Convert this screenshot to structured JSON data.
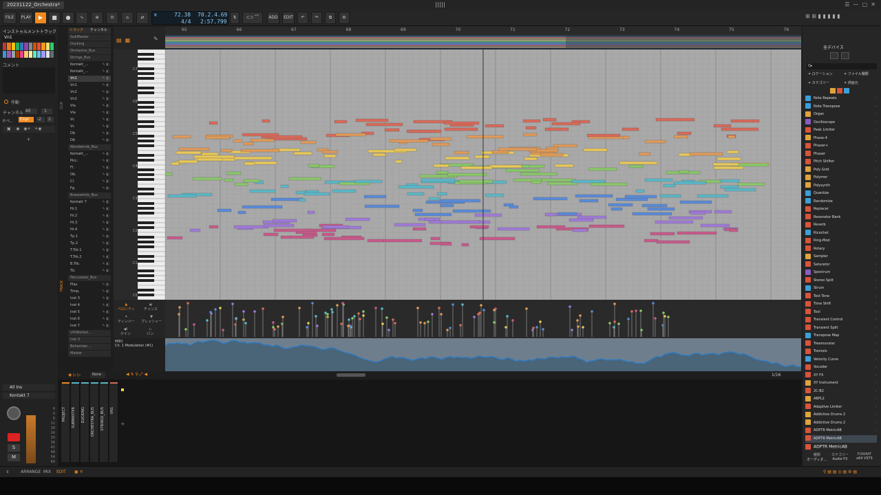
{
  "window": {
    "title": "20231122_Orchestra*"
  },
  "toolbar": {
    "file": "FILE",
    "play": "PLAY",
    "add": "ADD",
    "edit": "EDIT",
    "tempo": "72.38",
    "time_sig": "4/4",
    "position": "70.2.4.69",
    "time": "2:57.799",
    "accent": "#f08a1e"
  },
  "left_panel": {
    "header": "インストゥルメントトラック",
    "track_name": "Vn1",
    "comment": "コメント",
    "action": "作動",
    "channel_label": "チャンネル",
    "channel_value": "All",
    "channel_num": "1",
    "expr_label": "P.ベ..",
    "expr_value": "Expr",
    "expr_nums": "-2",
    "expr_num2": "2",
    "palette": [
      "#c0392b",
      "#e67e22",
      "#f1c40f",
      "#27ae60",
      "#2980b9",
      "#8e44ad",
      "#7f8c8d",
      "#d35400",
      "#e74c3c",
      "#f39c12",
      "#f7dc6f",
      "#2ecc71",
      "#3498db",
      "#9b59b6",
      "#95a5a6",
      "#a04000",
      "#e84393",
      "#fdcb6e",
      "#ffeaa7",
      "#55efc4",
      "#74b9ff",
      "#a29bfe",
      "#dfe6e9",
      "#636e72"
    ]
  },
  "tracklist": {
    "tab_track": "トラック",
    "tab_channel": "チャンネル",
    "clip_label": "CLIP",
    "track_label": "TRACK",
    "tracks": [
      {
        "name": "SubMaster",
        "bus": true
      },
      {
        "name": "Ducking",
        "bus": true
      },
      {
        "name": "Orchestra_Bus",
        "bus": true
      },
      {
        "name": "Strings_Bus",
        "bus": true
      },
      {
        "name": "Kontakt_..."
      },
      {
        "name": "Kontakt_..."
      },
      {
        "name": "Vn1",
        "sel": true
      },
      {
        "name": "Vn1"
      },
      {
        "name": "Vn2"
      },
      {
        "name": "Vn2"
      },
      {
        "name": "Vla"
      },
      {
        "name": "Vla"
      },
      {
        "name": "Vc"
      },
      {
        "name": "Vc"
      },
      {
        "name": "Db"
      },
      {
        "name": "Db"
      },
      {
        "name": "Woodwinds_Bus",
        "bus": true
      },
      {
        "name": "Kontakt_..."
      },
      {
        "name": "Picc."
      },
      {
        "name": "Fl."
      },
      {
        "name": "Ob."
      },
      {
        "name": "Cl."
      },
      {
        "name": "Fg."
      },
      {
        "name": "Brasswinds_Bus",
        "bus": true
      },
      {
        "name": "Kontakt 7"
      },
      {
        "name": "Hr.1"
      },
      {
        "name": "Hr.2"
      },
      {
        "name": "Hr.3"
      },
      {
        "name": "Hr.4"
      },
      {
        "name": "Tp.1"
      },
      {
        "name": "Tp.2"
      },
      {
        "name": "T.Trb.1"
      },
      {
        "name": "T.Trb.2"
      },
      {
        "name": "B.Trb."
      },
      {
        "name": "Tb."
      },
      {
        "name": "Percussion_Bus",
        "bus": true
      },
      {
        "name": "Play"
      },
      {
        "name": "Timp."
      },
      {
        "name": "Inst 3"
      },
      {
        "name": "Inst 4"
      },
      {
        "name": "Inst 5"
      },
      {
        "name": "Inst 6"
      },
      {
        "name": "Inst 7"
      },
      {
        "name": "UVIWorkst...",
        "bus": true
      },
      {
        "name": "Inst 3",
        "bus": true
      },
      {
        "name": "Bohemian ...",
        "bus": true
      },
      {
        "name": "Master",
        "bus": true
      }
    ]
  },
  "ruler": {
    "bars": [
      "65",
      "66",
      "67",
      "68",
      "69",
      "70",
      "71",
      "72",
      "73",
      "74",
      "75",
      "76"
    ]
  },
  "octaves": [
    "C7",
    "C6",
    "C5",
    "C4",
    "C3",
    "C2",
    "C1",
    "C0"
  ],
  "expression_panel": {
    "velocity": "ベロシティ",
    "chance": "チャンス",
    "timbre": "ティンバー",
    "pressure": "プレッシャー",
    "gain": "ゲイン",
    "pan": "パン"
  },
  "automation": {
    "type": "MIDI",
    "param": "Ch. 1 Modulation (#1)"
  },
  "editor_footer": {
    "none": "None",
    "grid": "1/16"
  },
  "mixer": {
    "input": "All Ins",
    "instrument": "Kontakt 7",
    "scale": [
      "6",
      "0",
      "6",
      "12",
      "18",
      "24",
      "30",
      "36",
      "42",
      "48",
      "54",
      "60"
    ],
    "solo": "S",
    "mute": "M",
    "strips": [
      "PROJECT",
      "SUBMASTER",
      "DUCKING",
      "ORCHESTRA_BUS",
      "STRINGS_BUS",
      "VN1"
    ]
  },
  "browser": {
    "title": "全デバイス",
    "search": "Q▸",
    "filters": [
      "ロケーション",
      "ファイル種類",
      "カテゴリー",
      "供給元"
    ],
    "items": [
      {
        "name": "Note Repeats",
        "color": "#3aa0d8"
      },
      {
        "name": "Note Transpose",
        "color": "#3aa0d8"
      },
      {
        "name": "Organ",
        "color": "#e0a33a"
      },
      {
        "name": "Oscilloscope",
        "color": "#8a5cc2"
      },
      {
        "name": "Peak Limiter",
        "color": "#d9533a"
      },
      {
        "name": "Phase-4",
        "color": "#e0a33a"
      },
      {
        "name": "Phaser+",
        "color": "#d9533a"
      },
      {
        "name": "Phaser",
        "color": "#d9533a"
      },
      {
        "name": "Pitch Shifter",
        "color": "#d9533a"
      },
      {
        "name": "Poly Grid",
        "color": "#e0a33a"
      },
      {
        "name": "Polymer",
        "color": "#e0a33a"
      },
      {
        "name": "Polysynth",
        "color": "#e0a33a"
      },
      {
        "name": "Quantize",
        "color": "#3aa0d8"
      },
      {
        "name": "Randomize",
        "color": "#3aa0d8"
      },
      {
        "name": "Replacer",
        "color": "#d9533a"
      },
      {
        "name": "Resonator Bank",
        "color": "#d9533a"
      },
      {
        "name": "Reverb",
        "color": "#d9533a"
      },
      {
        "name": "Ricochet",
        "color": "#3aa0d8"
      },
      {
        "name": "Ring-Mod",
        "color": "#d9533a"
      },
      {
        "name": "Rotary",
        "color": "#d9533a"
      },
      {
        "name": "Sampler",
        "color": "#e0a33a"
      },
      {
        "name": "Saturator",
        "color": "#d9533a"
      },
      {
        "name": "Spectrum",
        "color": "#8a5cc2"
      },
      {
        "name": "Stereo Split",
        "color": "#d9533a"
      },
      {
        "name": "Strum",
        "color": "#3aa0d8"
      },
      {
        "name": "Test Tone",
        "color": "#d9533a"
      },
      {
        "name": "Time Shift",
        "color": "#d9533a"
      },
      {
        "name": "Tool",
        "color": "#d9533a"
      },
      {
        "name": "Transient Control",
        "color": "#d9533a"
      },
      {
        "name": "Transient Split",
        "color": "#d9533a"
      },
      {
        "name": "Transpose Map",
        "color": "#3aa0d8"
      },
      {
        "name": "Treemonster",
        "color": "#d9533a"
      },
      {
        "name": "Tremolo",
        "color": "#d9533a"
      },
      {
        "name": "Velocity Curve",
        "color": "#3aa0d8"
      },
      {
        "name": "Vocoder",
        "color": "#d9533a"
      },
      {
        "name": "XY FX",
        "color": "#d9533a"
      },
      {
        "name": "XY Instrument",
        "color": "#e0a33a"
      },
      {
        "name": "2C-B2",
        "color": "#d9533a"
      },
      {
        "name": "ABPL2",
        "color": "#e0a33a"
      },
      {
        "name": "Adaptive Limiter",
        "color": "#d9533a"
      },
      {
        "name": "Addictive Drums 2",
        "color": "#e0a33a"
      },
      {
        "name": "Addictive Drums 2",
        "color": "#e0a33a"
      },
      {
        "name": "ADPTR MetricAB",
        "color": "#d9533a"
      },
      {
        "name": "ADPTR MetricAB",
        "color": "#d9533a",
        "sel": true
      }
    ],
    "footer_name": "ADPTR MetricAB",
    "footer_cols": [
      [
        "種類",
        "オーディオ..."
      ],
      [
        "カテゴリー",
        "Audio FX"
      ],
      [
        "FORMAT",
        "x64 VST3"
      ]
    ]
  },
  "statusbar": {
    "arrange": "ARRANGE",
    "mix": "MIX",
    "edit": "EDIT"
  }
}
